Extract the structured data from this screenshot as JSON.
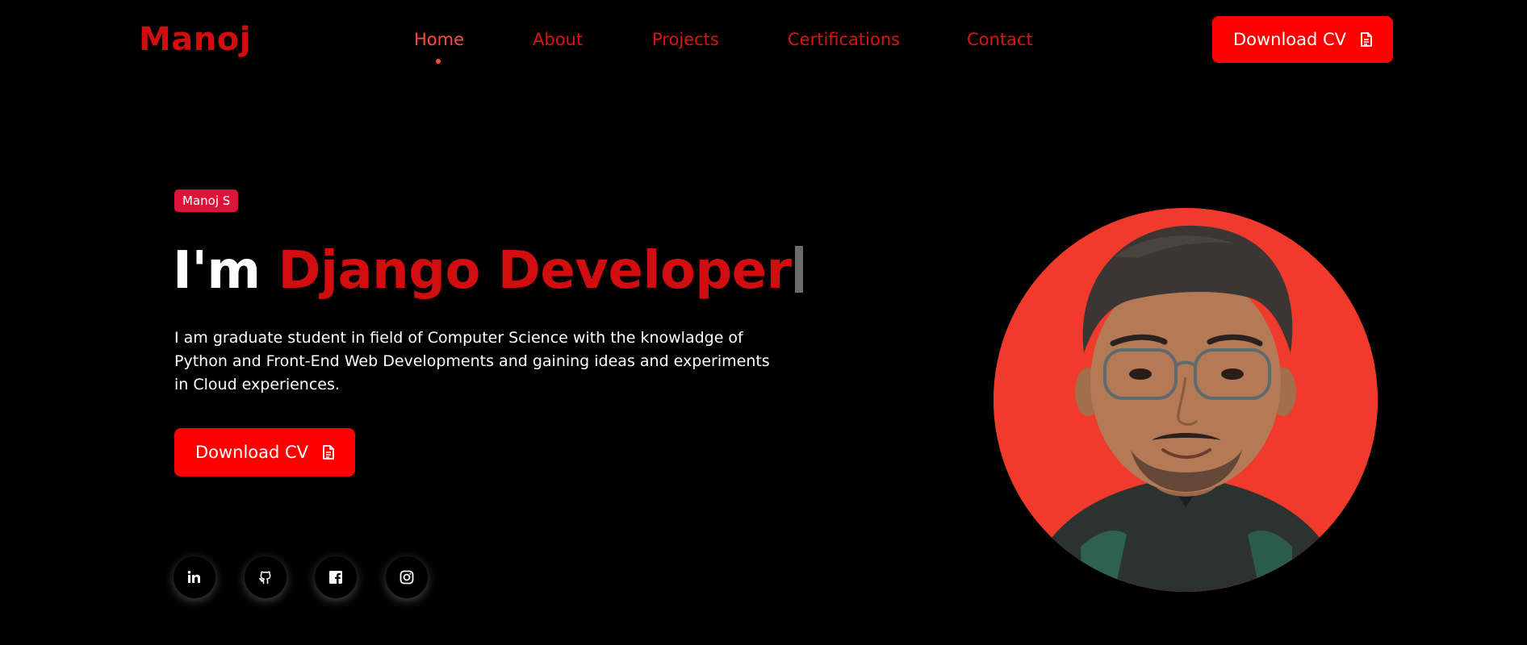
{
  "header": {
    "logo": "Manoj",
    "nav": [
      {
        "label": "Home",
        "active": true
      },
      {
        "label": "About",
        "active": false
      },
      {
        "label": "Projects",
        "active": false
      },
      {
        "label": "Certifications",
        "active": false
      },
      {
        "label": "Contact",
        "active": false
      }
    ],
    "cv_button": {
      "label": "Download CV",
      "icon": "document-icon"
    }
  },
  "hero": {
    "badge": "Manoj S",
    "headline_lead": "I'm ",
    "headline_role": "Django Developer",
    "description": "I am graduate student in field of Computer Science with the knowladge of Python and Front-End Web Developments and gaining ideas and experiments in Cloud experiences.",
    "cv_button": {
      "label": "Download CV",
      "icon": "document-icon"
    },
    "socials": [
      {
        "name": "linkedin",
        "icon": "linkedin-icon"
      },
      {
        "name": "github",
        "icon": "github-icon"
      },
      {
        "name": "facebook",
        "icon": "facebook-icon"
      },
      {
        "name": "instagram",
        "icon": "instagram-icon"
      }
    ]
  },
  "portrait": {
    "alt_icon": "profile-photo"
  },
  "colors": {
    "background": "#000000",
    "brand_red": "#d10d10",
    "nav_red": "#e0110f",
    "active_nav": "#ff4b47",
    "button_red": "#ff0000",
    "badge": "#dc143c",
    "portrait_bg": "#f03a2c"
  }
}
